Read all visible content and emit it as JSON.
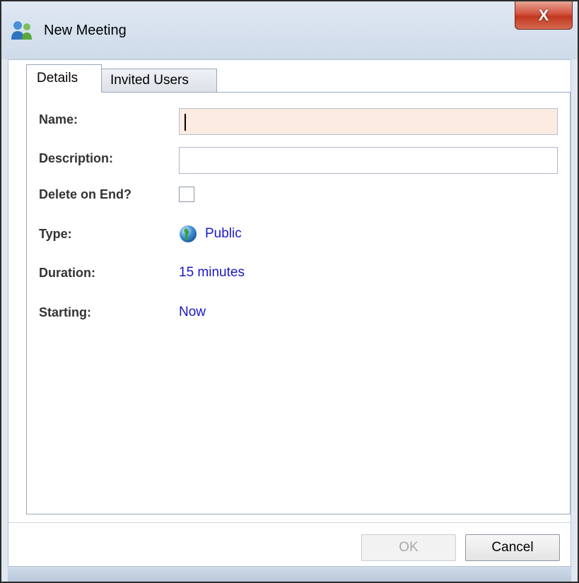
{
  "window": {
    "title": "New Meeting",
    "close_glyph": "X",
    "app_icon": "users-icon"
  },
  "tabs": [
    {
      "label": "Details",
      "active": true
    },
    {
      "label": "Invited Users",
      "active": false
    }
  ],
  "form": {
    "name": {
      "label": "Name:",
      "value": "",
      "focused": true
    },
    "description": {
      "label": "Description:",
      "value": ""
    },
    "delete_on_end": {
      "label": "Delete on End?",
      "checked": false
    },
    "type": {
      "label": "Type:",
      "value": "Public",
      "icon": "globe-icon"
    },
    "duration": {
      "label": "Duration:",
      "value": "15 minutes"
    },
    "starting": {
      "label": "Starting:",
      "value": "Now"
    }
  },
  "buttons": {
    "ok": {
      "label": "OK",
      "enabled": false
    },
    "cancel": {
      "label": "Cancel",
      "enabled": true
    }
  },
  "colors": {
    "link": "#1a17c8",
    "focused_input_bg": "#fbebe1",
    "close_button": "#c2371f"
  }
}
